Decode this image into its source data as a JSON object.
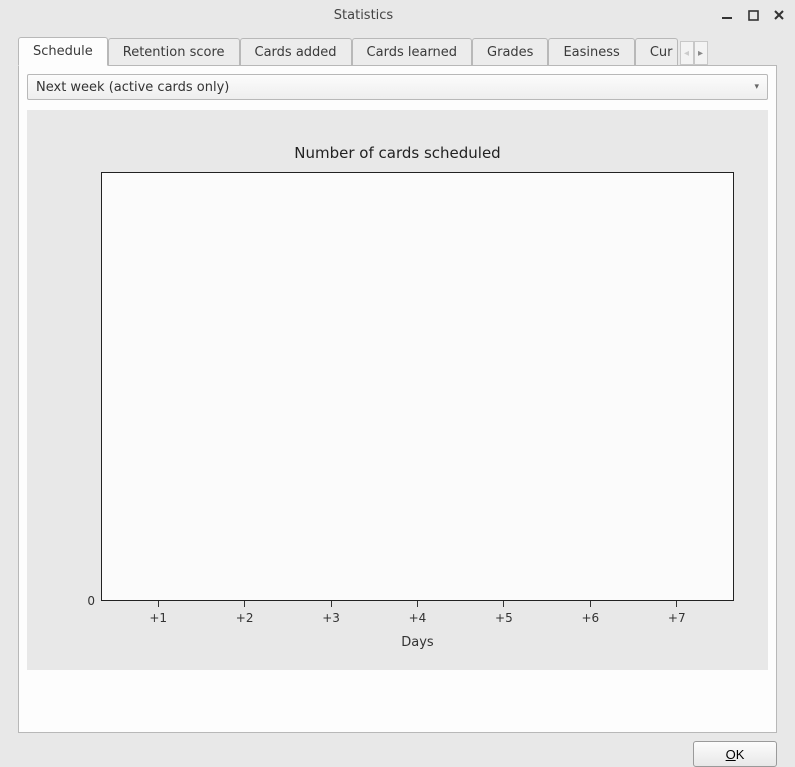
{
  "window": {
    "title": "Statistics"
  },
  "tabs": [
    {
      "label": "Schedule",
      "active": true
    },
    {
      "label": "Retention score",
      "active": false
    },
    {
      "label": "Cards added",
      "active": false
    },
    {
      "label": "Cards learned",
      "active": false
    },
    {
      "label": "Grades",
      "active": false
    },
    {
      "label": "Easiness",
      "active": false
    },
    {
      "label": "Cur",
      "active": false
    }
  ],
  "range_selector": {
    "value": "Next week (active cards only)"
  },
  "chart_data": {
    "type": "bar",
    "title": "Number of cards scheduled",
    "categories": [
      "+1",
      "+2",
      "+3",
      "+4",
      "+5",
      "+6",
      "+7"
    ],
    "values": [
      0,
      0,
      0,
      0,
      0,
      0,
      0
    ],
    "xlabel": "Days",
    "ylabel": "",
    "ylim": [
      0,
      1
    ],
    "yticks_visible": [
      "0"
    ]
  },
  "footer": {
    "ok_label": "OK"
  }
}
